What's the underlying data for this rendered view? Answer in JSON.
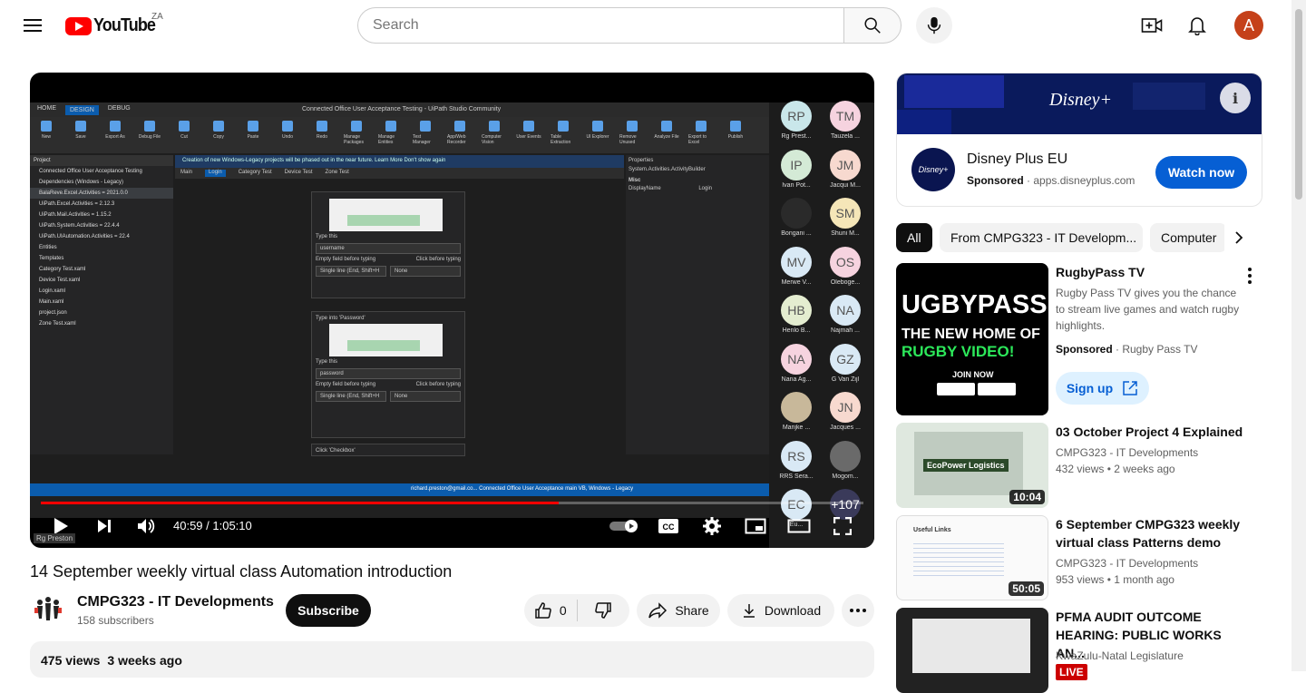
{
  "header": {
    "logo_text": "YouTube",
    "country": "ZA",
    "search_placeholder": "Search",
    "avatar_letter": "A",
    "avatar_color": "#c5411a"
  },
  "player": {
    "time_current": "40:59",
    "time_total": "1:05:10",
    "time_display": "40:59 / 1:05:10",
    "progress": 0.629,
    "presenter_tag": "Rg Preston",
    "studio": {
      "title": "Connected Office User Acceptance Testing - UiPath Studio Community",
      "tabs": [
        "HOME",
        "DESIGN",
        "DEBUG"
      ],
      "ribbon": [
        "New",
        "Save",
        "Export As",
        "Debug File",
        "Cut",
        "Copy",
        "Paste",
        "Undo",
        "Redo",
        "Manage Packages",
        "Manage Entities",
        "Test Manager",
        "App/Web Recorder",
        "Computer Vision",
        "User Events",
        "Table Extraction",
        "UI Explorer",
        "Remove Unused",
        "Analyze File",
        "Export to Excel",
        "Publish"
      ],
      "banner": "Creation of new Windows-Legacy projects will be phased out in the near future. Learn More  Don't show again",
      "doc_tabs": [
        "Main",
        "Login",
        "Category Test",
        "Device Test",
        "Zone Test"
      ],
      "project_header": "Project",
      "project_rows": [
        "Connected Office User Acceptance Testing",
        "Dependencies (Windows - Legacy)",
        "BalaReve.Excel.Activities = 2021.0.0",
        "UiPath.Excel.Activities = 2.12.3",
        "UiPath.Mail.Activities = 1.15.2",
        "UiPath.System.Activities = 22.4.4",
        "UiPath.UIAutomation.Activities = 22.4",
        "Entities",
        "Templates",
        "Category Test.xaml",
        "Device Test.xaml",
        "Login.xaml",
        "Main.xaml",
        "project.json",
        "Zone Test.xaml"
      ],
      "activity1": {
        "type_this": "Type this",
        "value": "username",
        "empty": "Empty field before typing",
        "click": "Click before typing",
        "opt1": "Single line (End, Shift+H",
        "opt2": "None"
      },
      "activity2": {
        "title": "Type into 'Password'",
        "type_this": "Type this",
        "value": "password",
        "empty": "Empty field before typing",
        "click": "Click before typing",
        "opt1": "Single line (End, Shift+H",
        "opt2": "None"
      },
      "activity3": {
        "title": "Click 'Checkbox'"
      },
      "properties_header": "Properties",
      "properties_sub": "System.Activities.ActivityBuilder",
      "prop_misc": "Misc",
      "prop_name": "DisplayName",
      "prop_val": "Login",
      "status": "richard.preston@gmail.co...   Connected Office User Acceptance   main   VB, Windows - Legacy"
    },
    "participants": [
      {
        "initials": "RP",
        "name": "Rg Prest...",
        "color": "#c9e7ea"
      },
      {
        "initials": "TM",
        "name": "Tauzela ...",
        "color": "#f6d3df"
      },
      {
        "initials": "IP",
        "name": "Ivan Pot...",
        "color": "#d4ead6"
      },
      {
        "initials": "JM",
        "name": "Jacqui M...",
        "color": "#f7d9cf"
      },
      {
        "initials": "",
        "name": "Bongani ...",
        "color": "#2a2a2a"
      },
      {
        "initials": "SM",
        "name": "Shuni M...",
        "color": "#f5e6b8"
      },
      {
        "initials": "MV",
        "name": "Merwe V...",
        "color": "#d9e9f5"
      },
      {
        "initials": "OS",
        "name": "Olebogе...",
        "color": "#f6d3df"
      },
      {
        "initials": "HB",
        "name": "Henlo B...",
        "color": "#e4edd0"
      },
      {
        "initials": "NA",
        "name": "Najmah ...",
        "color": "#d9e9f5"
      },
      {
        "initials": "NA",
        "name": "Nana Ag...",
        "color": "#f6d3df"
      },
      {
        "initials": "GZ",
        "name": "G Van Zijl",
        "color": "#d9e9f5"
      },
      {
        "initials": "",
        "name": "Marijke ...",
        "color": "#c8b89a"
      },
      {
        "initials": "JN",
        "name": "Jacques ...",
        "color": "#f7d9cf"
      },
      {
        "initials": "RS",
        "name": "RRS Sera...",
        "color": "#d9e9f5"
      },
      {
        "initials": "",
        "name": "Mogom...",
        "color": "#6a6a6a"
      },
      {
        "initials": "EC",
        "name": "Eu...",
        "color": "#d9e9f5"
      },
      {
        "initials": "+107",
        "name": "",
        "color": "#3a3a5a"
      }
    ]
  },
  "video": {
    "title": "14 September weekly virtual class Automation introduction",
    "channel": "CMPG323 - IT Developments",
    "subscribers": "158 subscribers",
    "subscribe_label": "Subscribe",
    "likes": "0",
    "share_label": "Share",
    "download_label": "Download",
    "views": "475 views",
    "age": "3 weeks ago"
  },
  "ad": {
    "title": "Disney Plus EU",
    "sponsored": "Sponsored",
    "domain": "apps.disneyplus.com",
    "cta": "Watch now",
    "banner_logo": "Disney+",
    "icon_text": "Disney+"
  },
  "chips": [
    "All",
    "From CMPG323 - IT Developm...",
    "Computer"
  ],
  "recs": [
    {
      "title": "RugbyPass TV",
      "desc": "Rugby Pass TV gives you the chance to stream live games and watch rugby highlights.",
      "sponsored": "Sponsored",
      "advertiser": "Rugby Pass TV",
      "cta": "Sign up",
      "thumb_line1": "UGBYPASS T",
      "thumb_line2": "THE NEW HOME OF",
      "thumb_line3": "RUGBY VIDEO!",
      "thumb_line4": "JOIN NOW"
    },
    {
      "title": "03 October Project 4 Explained",
      "channel": "CMPG323 - IT Developments",
      "meta": "432 views • 2 weeks ago",
      "duration": "10:04",
      "thumb_text": "EcoPower Logistics"
    },
    {
      "title": "6 September CMPG323 weekly virtual class Patterns demo",
      "channel": "CMPG323 - IT Developments",
      "meta": "953 views • 1 month ago",
      "duration": "50:05",
      "thumb_text": "Useful Links"
    },
    {
      "title": "PFMA AUDIT OUTCOME HEARING: PUBLIC WORKS AN...",
      "channel": "KwaZulu-Natal Legislature",
      "live": "LIVE"
    }
  ]
}
